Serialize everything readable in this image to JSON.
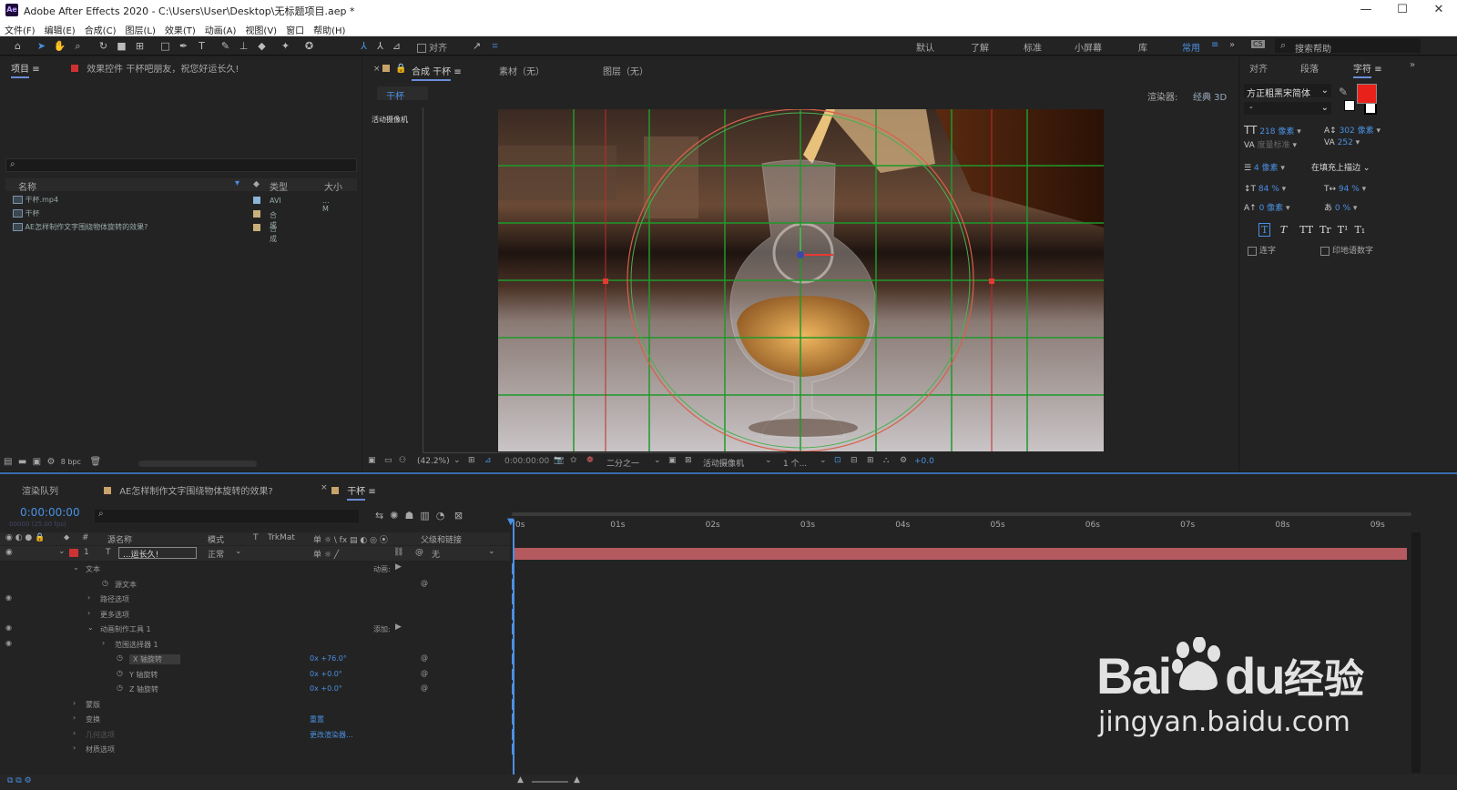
{
  "window": {
    "app_icon": "Ae",
    "title": "Adobe After Effects 2020 - C:\\Users\\User\\Desktop\\无标题项目.aep *",
    "min": "—",
    "max": "☐",
    "close": "✕"
  },
  "menu": [
    "文件(F)",
    "编辑(E)",
    "合成(C)",
    "图层(L)",
    "效果(T)",
    "动画(A)",
    "视图(V)",
    "窗口",
    "帮助(H)"
  ],
  "toolbar": {
    "snap_label": "对齐",
    "workspaces": [
      "默认",
      "了解",
      "标准",
      "小屏幕",
      "库",
      "常用"
    ],
    "search_placeholder": "搜索帮助"
  },
  "project": {
    "tab": "项目",
    "effect_tab": "效果控件 干杯吧朋友，祝您好运长久!",
    "columns": {
      "name": "名称",
      "type": "类型",
      "size": "大小"
    },
    "items": [
      {
        "name": "干杯.mp4",
        "type": "AVI",
        "size": "... M"
      },
      {
        "name": "干杯",
        "type": "合成",
        "size": ""
      },
      {
        "name": "AE怎样制作文字围绕物体旋转的效果?",
        "type": "合成",
        "size": ""
      }
    ],
    "bpc": "8 bpc"
  },
  "comp": {
    "tab": "合成 干杯",
    "footage_tab": "素材（无）",
    "layer_tab": "图层（无）",
    "breadcrumb": "干杯",
    "renderer_label": "渲染器:",
    "renderer": "经典 3D",
    "camera_label": "活动摄像机",
    "zoom": "(42.2%)",
    "timecode": "0:00:00:00",
    "resolution": "二分之一",
    "view_camera": "活动摄像机",
    "views": "1 个...",
    "exposure": "+0.0"
  },
  "character": {
    "tabs": [
      "对齐",
      "段落",
      "字符"
    ],
    "font": "方正粗黑宋简体",
    "style": "-",
    "size": "218 像素",
    "leading": "302 像素",
    "kerning": "度量标准",
    "tracking": "252",
    "stroke_width": "4 像素",
    "stroke_type": "在填充上描边",
    "vscale": "84 %",
    "hscale": "94 %",
    "baseline": "0 像素",
    "tsume": "0 %",
    "styles": [
      "T",
      "T",
      "TT",
      "Tr",
      "T¹",
      "T₁"
    ],
    "ligatures": "连字",
    "hindi": "印地语数字",
    "fill_color": "#e8221b"
  },
  "timeline": {
    "tabs": [
      "渲染队列",
      "AE怎样制作文字围绕物体旋转的效果?",
      "干杯"
    ],
    "timecode": "0:00:00:00",
    "fps": "00000 (25.00 fps)",
    "columns": {
      "num": "#",
      "source": "源名称",
      "mode": "模式",
      "t": "T",
      "trkmat": "TrkMat",
      "switches": "单 ☼ \\ fx ▤ ◐ ◎ ⦿",
      "parent": "父级和链接"
    },
    "layer": {
      "num": "1",
      "name": "...运长久!",
      "mode": "正常",
      "parent": "无"
    },
    "ruler": [
      "0s",
      "01s",
      "02s",
      "03s",
      "04s",
      "05s",
      "06s",
      "07s",
      "08s",
      "09s"
    ],
    "props": [
      {
        "label": "文本",
        "indent": 1,
        "extra": "动画:"
      },
      {
        "label": "源文本",
        "indent": 3,
        "extra": ""
      },
      {
        "label": "路径选项",
        "indent": 2,
        "extra": ""
      },
      {
        "label": "更多选项",
        "indent": 2,
        "extra": ""
      },
      {
        "label": "动画制作工具 1",
        "indent": 2,
        "extra": "添加:"
      },
      {
        "label": "范围选择器 1",
        "indent": 3,
        "extra": ""
      },
      {
        "label": "X 轴旋转",
        "indent": 4,
        "extra": "0x +76.0°"
      },
      {
        "label": "Y 轴旋转",
        "indent": 4,
        "extra": "0x +0.0°"
      },
      {
        "label": "Z 轴旋转",
        "indent": 4,
        "extra": "0x +0.0°"
      },
      {
        "label": "蒙版",
        "indent": 1,
        "extra": ""
      },
      {
        "label": "变换",
        "indent": 1,
        "extra": "重置"
      },
      {
        "label": "几何选项",
        "indent": 1,
        "extra": "更改渲染器..."
      },
      {
        "label": "材质选项",
        "indent": 1,
        "extra": ""
      }
    ]
  },
  "watermark": {
    "brand": "Bai",
    "brand2": "du",
    "cn": "经验",
    "url": "jingyan.baidu.com"
  }
}
